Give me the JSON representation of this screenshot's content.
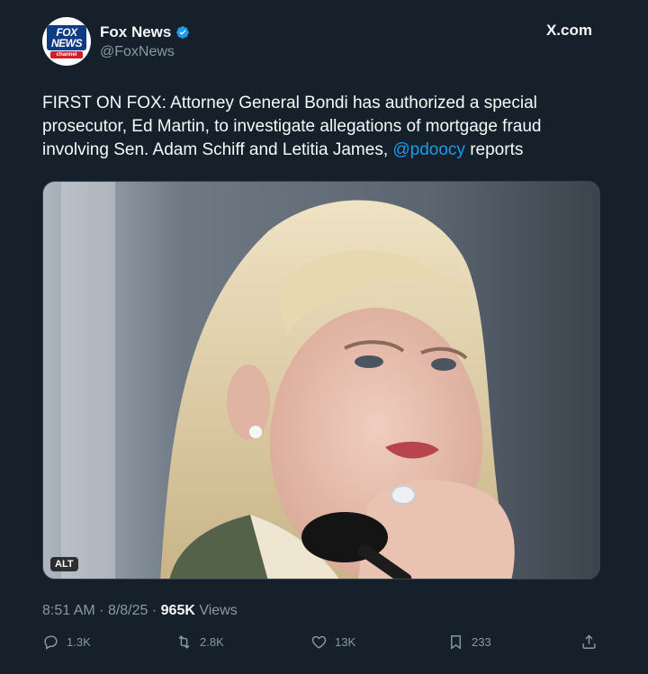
{
  "header": {
    "name": "Fox News",
    "handle": "@FoxNews",
    "source": "X.com",
    "avatar_text_top": "FOX",
    "avatar_text_bottom": "NEWS",
    "avatar_badge": "channel"
  },
  "tweet": {
    "text_before": "FIRST ON FOX: Attorney General Bondi has authorized a special prosecutor, Ed Martin, to investigate allegations of mortgage fraud involving Sen. Adam Schiff and Letitia James, ",
    "mention": "@pdoocy",
    "text_after": " reports"
  },
  "media": {
    "alt_badge": "ALT"
  },
  "meta": {
    "time": "8:51 AM",
    "separator": "·",
    "date": "8/8/25",
    "views_count": "965K",
    "views_label": "Views"
  },
  "actions": {
    "replies": "1.3K",
    "reposts": "2.8K",
    "likes": "13K",
    "bookmarks": "233"
  },
  "colors": {
    "background": "#15202b",
    "text": "#f7f9f9",
    "secondary": "#8b98a5",
    "accent": "#1d9bf0"
  }
}
